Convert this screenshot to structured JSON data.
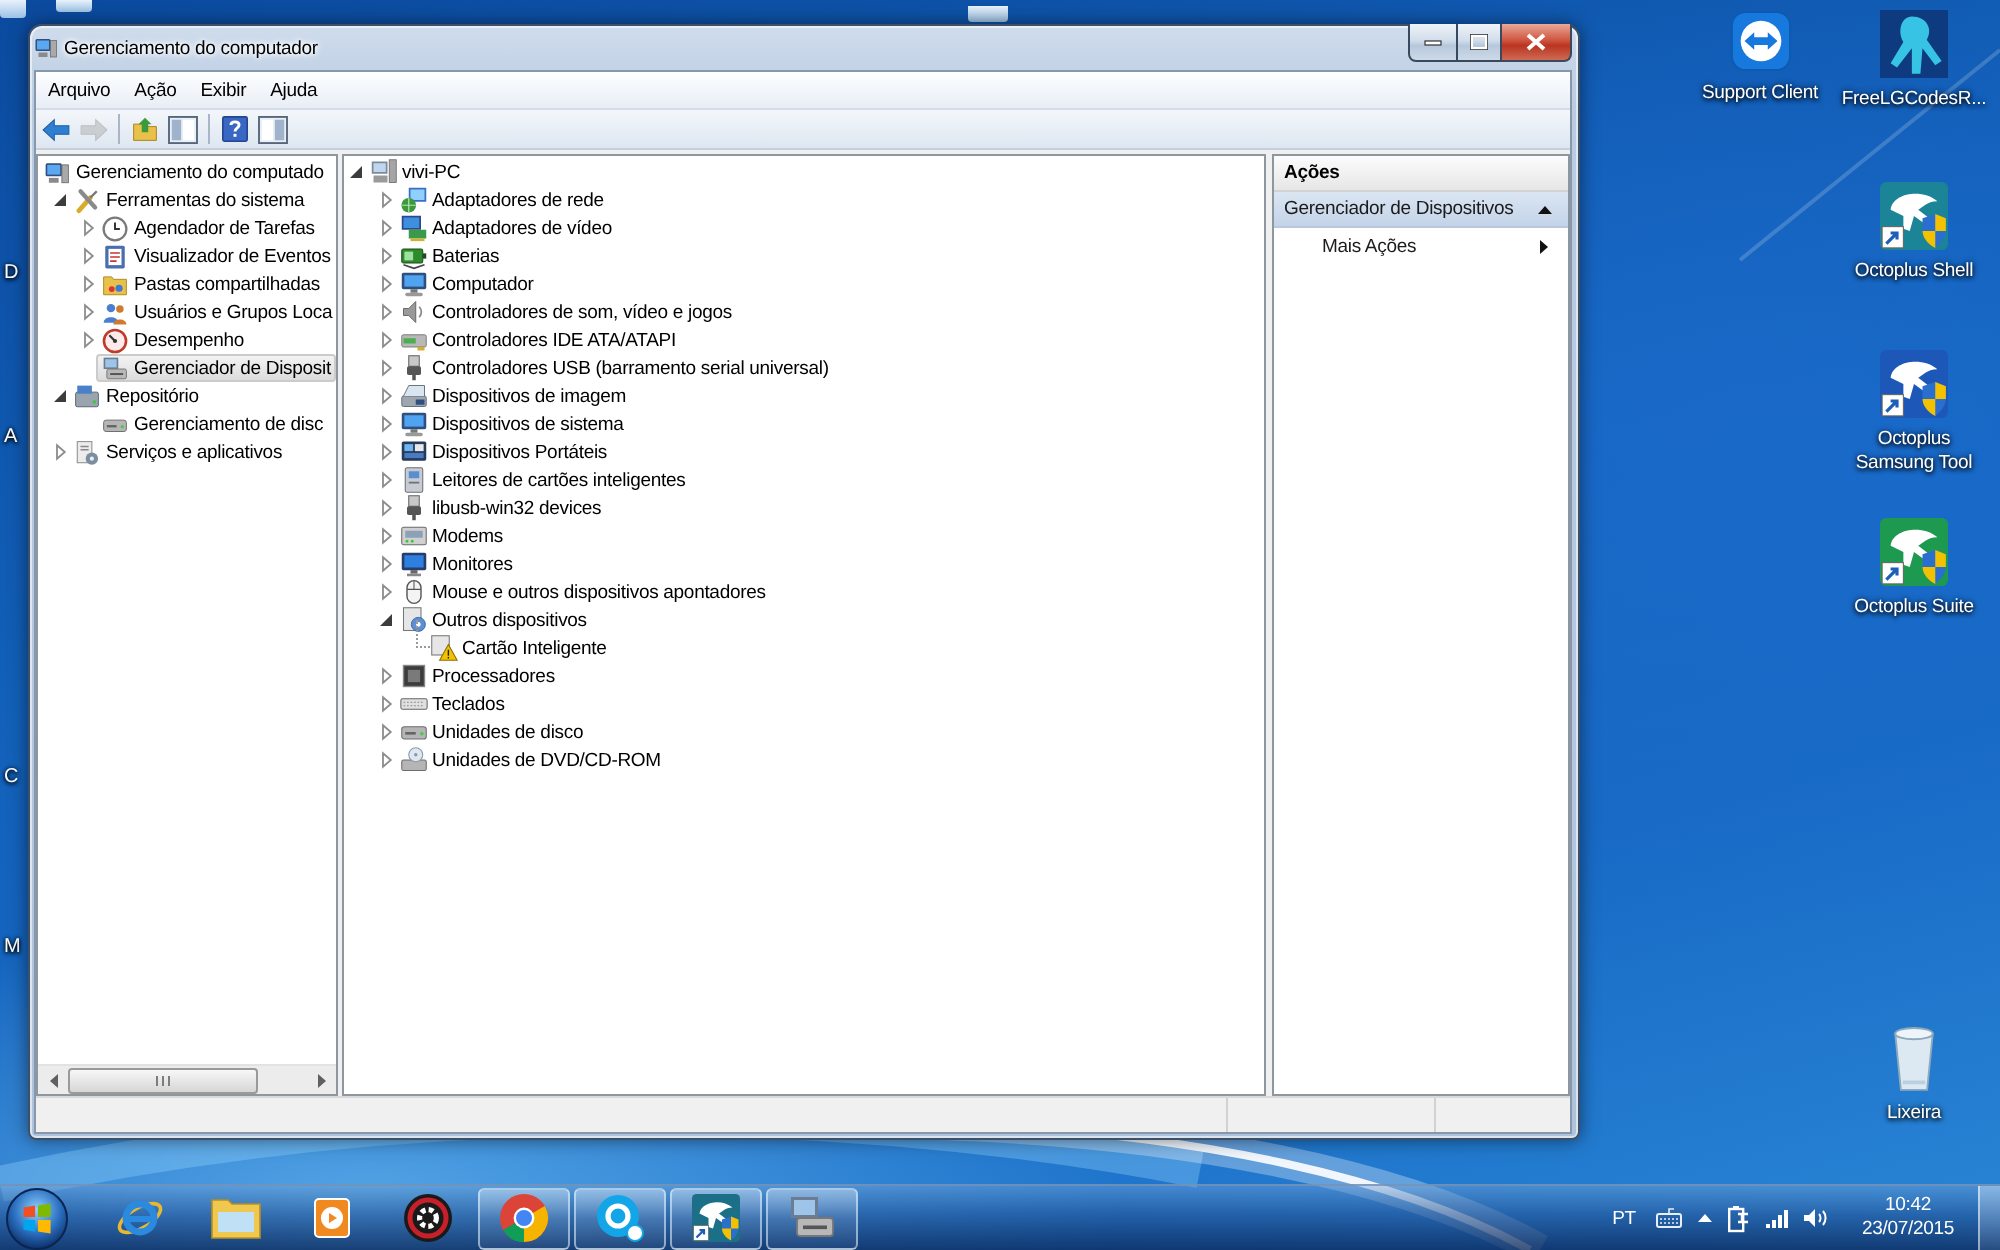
{
  "window": {
    "title": "Gerenciamento do computador"
  },
  "menu": [
    {
      "label": "Arquivo"
    },
    {
      "label": "Ação"
    },
    {
      "label": "Exibir"
    },
    {
      "label": "Ajuda"
    }
  ],
  "toolbar": [
    {
      "buttons": [
        {
          "disabled": false
        },
        {
          "disabled": true
        }
      ]
    },
    {
      "buttons": [
        {
          "disabled": false
        },
        {
          "disabled": false
        }
      ]
    },
    {
      "buttons": [
        {
          "disabled": false
        },
        {
          "disabled": false
        }
      ]
    }
  ],
  "console_tree": {
    "items": [
      {
        "label": "Gerenciamento do computado",
        "selected": false,
        "children": [
          {
            "label": "Ferramentas do sistema",
            "expanded": true,
            "selected": false,
            "children": [
              {
                "label": "Agendador de Tarefas",
                "expanded": false,
                "selected": false
              },
              {
                "label": "Visualizador de Eventos",
                "expanded": false,
                "selected": false
              },
              {
                "label": "Pastas compartilhadas",
                "expanded": false,
                "selected": false
              },
              {
                "label": "Usuários e Grupos Loca",
                "expanded": false,
                "selected": false
              },
              {
                "label": "Desempenho",
                "expanded": false,
                "selected": false
              },
              {
                "label": "Gerenciador de Disposit",
                "selected": true
              }
            ]
          },
          {
            "label": "Repositório",
            "expanded": true,
            "selected": false,
            "children": [
              {
                "label": "Gerenciamento de disc",
                "selected": false
              }
            ]
          },
          {
            "label": "Serviços e aplicativos",
            "expanded": false,
            "selected": false
          }
        ]
      }
    ]
  },
  "device_tree": {
    "items": [
      {
        "label": "vivi-PC",
        "expanded": true,
        "selected": false,
        "children": [
          {
            "label": "Adaptadores de rede",
            "expanded": false,
            "selected": false
          },
          {
            "label": "Adaptadores de vídeo",
            "expanded": false,
            "selected": false
          },
          {
            "label": "Baterias",
            "expanded": false,
            "selected": false
          },
          {
            "label": "Computador",
            "expanded": false,
            "selected": false
          },
          {
            "label": "Controladores de som, vídeo e jogos",
            "expanded": false,
            "selected": false
          },
          {
            "label": "Controladores IDE ATA/ATAPI",
            "expanded": false,
            "selected": false
          },
          {
            "label": "Controladores USB (barramento serial universal)",
            "expanded": false,
            "selected": false
          },
          {
            "label": "Dispositivos de imagem",
            "expanded": false,
            "selected": false
          },
          {
            "label": "Dispositivos de sistema",
            "expanded": false,
            "selected": false
          },
          {
            "label": "Dispositivos Portáteis",
            "expanded": false,
            "selected": false
          },
          {
            "label": "Leitores de cartões inteligentes",
            "expanded": false,
            "selected": false
          },
          {
            "label": "libusb-win32 devices",
            "expanded": false,
            "selected": false
          },
          {
            "label": "Modems",
            "expanded": false,
            "selected": false
          },
          {
            "label": "Monitores",
            "expanded": false,
            "selected": false
          },
          {
            "label": "Mouse e outros dispositivos apontadores",
            "expanded": false,
            "selected": false
          },
          {
            "label": "Outros dispositivos",
            "expanded": true,
            "selected": false,
            "children": [
              {
                "label": "Cartão Inteligente",
                "selected": false
              }
            ]
          },
          {
            "label": "Processadores",
            "expanded": false,
            "selected": false
          },
          {
            "label": "Teclados",
            "expanded": false,
            "selected": false
          },
          {
            "label": "Unidades de disco",
            "expanded": false,
            "selected": false
          },
          {
            "label": "Unidades de DVD/CD-ROM",
            "expanded": false,
            "selected": false
          }
        ]
      }
    ]
  },
  "actions": {
    "title": "Ações",
    "sections": [
      {
        "title": "Gerenciador de Dispositivos",
        "expanded": true,
        "items": [
          {
            "label": "Mais Ações",
            "kind": "submenu"
          }
        ]
      }
    ]
  },
  "desktop": {
    "edge_labels": [
      {
        "label": "D"
      },
      {
        "label": "A"
      },
      {
        "label": "C"
      },
      {
        "label": "M"
      }
    ],
    "icons": [
      {
        "label": "Support Client"
      },
      {
        "label": "FreeLGCodesR..."
      },
      {
        "label": "Octoplus Shell"
      },
      {
        "label": "Octoplus Samsung Tool"
      },
      {
        "label": "Octoplus Suite"
      },
      {
        "label": "Lixeira"
      }
    ]
  },
  "taskbar": {
    "apps": [
      {
        "running": false
      },
      {
        "running": false
      },
      {
        "running": false
      },
      {
        "running": false
      },
      {
        "running": true
      },
      {
        "running": true
      },
      {
        "running": true
      },
      {
        "running": true
      }
    ],
    "language": "PT",
    "time": "10:42",
    "date": "23/07/2015"
  }
}
